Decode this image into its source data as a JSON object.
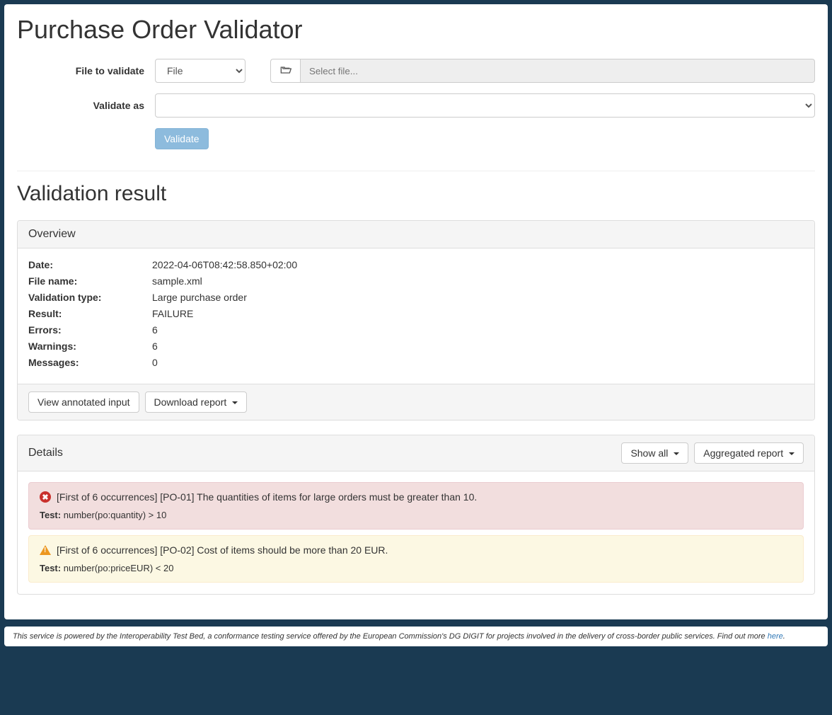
{
  "page": {
    "title": "Purchase Order Validator"
  },
  "form": {
    "file_label": "File to validate",
    "file_select_value": "File",
    "file_input_placeholder": "Select file...",
    "validate_as_label": "Validate as",
    "validate_button": "Validate"
  },
  "result": {
    "heading": "Validation result",
    "overview_title": "Overview",
    "rows": {
      "date_label": "Date:",
      "date_value": "2022-04-06T08:42:58.850+02:00",
      "filename_label": "File name:",
      "filename_value": "sample.xml",
      "type_label": "Validation type:",
      "type_value": "Large purchase order",
      "result_label": "Result:",
      "result_value": "FAILURE",
      "errors_label": "Errors:",
      "errors_value": "6",
      "warnings_label": "Warnings:",
      "warnings_value": "6",
      "messages_label": "Messages:",
      "messages_value": "0"
    },
    "view_annotated_button": "View annotated input",
    "download_report_button": "Download report"
  },
  "details": {
    "title": "Details",
    "show_all_button": "Show all",
    "aggregated_button": "Aggregated report",
    "items": [
      {
        "severity": "error",
        "message": "[First of 6 occurrences] [PO-01] The quantities of items for large orders must be greater than 10.",
        "test_label": "Test:",
        "test_expr": "number(po:quantity) > 10"
      },
      {
        "severity": "warning",
        "message": "[First of 6 occurrences] [PO-02] Cost of items should be more than 20 EUR.",
        "test_label": "Test:",
        "test_expr": "number(po:priceEUR) < 20"
      }
    ]
  },
  "footer": {
    "text": "This service is powered by the Interoperability Test Bed, a conformance testing service offered by the European Commission's DG DIGIT for projects involved in the delivery of cross-border public services. Find out more ",
    "link_text": "here",
    "period": "."
  }
}
